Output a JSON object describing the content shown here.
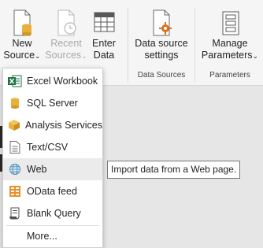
{
  "ribbon": {
    "new_source": {
      "line1": "New",
      "line2": "Source",
      "chevron": "⌄",
      "icon": "new-source-icon"
    },
    "recent_sources": {
      "line1": "Recent",
      "line2": "Sources",
      "chevron": "⌄",
      "icon": "recent-sources-icon"
    },
    "enter_data": {
      "line1": "Enter",
      "line2": "Data",
      "icon": "table-icon"
    },
    "data_source_settings": {
      "line1": "Data source",
      "line2": "settings",
      "icon": "data-source-settings-icon"
    },
    "manage_parameters": {
      "line1": "Manage",
      "line2": "Parameters",
      "chevron": "⌄",
      "icon": "parameters-icon"
    },
    "groups": {
      "data_sources": "Data Sources",
      "parameters": "Parameters"
    }
  },
  "menu": {
    "items": [
      {
        "label": "Excel Workbook",
        "icon": "excel-icon"
      },
      {
        "label": "SQL Server",
        "icon": "database-icon"
      },
      {
        "label": "Analysis Services",
        "icon": "cube-icon"
      },
      {
        "label": "Text/CSV",
        "icon": "text-file-icon"
      },
      {
        "label": "Web",
        "icon": "globe-icon"
      },
      {
        "label": "OData feed",
        "icon": "odata-icon"
      },
      {
        "label": "Blank Query",
        "icon": "blank-query-icon"
      }
    ],
    "more": "More...",
    "hovered": "Web"
  },
  "tooltip": "Import data from a Web page.",
  "colors": {
    "excel_green": "#1e7145",
    "gold": "#e8b13b",
    "orange": "#d86f1c",
    "globe_blue": "#4a90c2",
    "accent_grey": "#595959"
  }
}
